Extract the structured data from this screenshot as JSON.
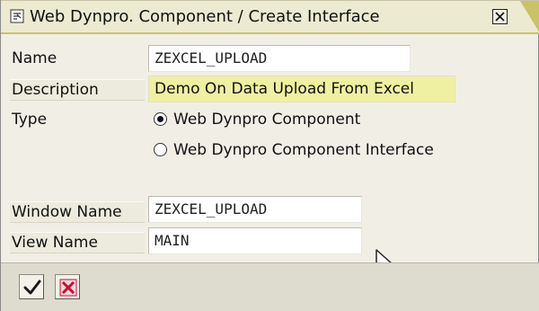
{
  "window": {
    "title": "Web Dynpro. Component / Create Interface"
  },
  "form": {
    "name": {
      "label": "Name",
      "value": "ZEXCEL_UPLOAD"
    },
    "description": {
      "label": "Description",
      "value": "Demo On Data Upload From Excel"
    },
    "type": {
      "label": "Type",
      "options": [
        {
          "label": "Web Dynpro Component",
          "selected": true
        },
        {
          "label": "Web Dynpro Component Interface",
          "selected": false
        }
      ]
    },
    "window_name": {
      "label": "Window Name",
      "value": "ZEXCEL_UPLOAD"
    },
    "view_name": {
      "label": "View Name",
      "value": "MAIN"
    }
  },
  "toolbar": {
    "confirm_icon": "checkmark-icon",
    "cancel_icon": "cancel-x-icon"
  },
  "colors": {
    "titlebar": "#ecebd1",
    "title_accent": "#c9c266",
    "description_highlight": "#f0f0a2",
    "cancel_red": "#c8102e",
    "background": "#f1eee6"
  }
}
